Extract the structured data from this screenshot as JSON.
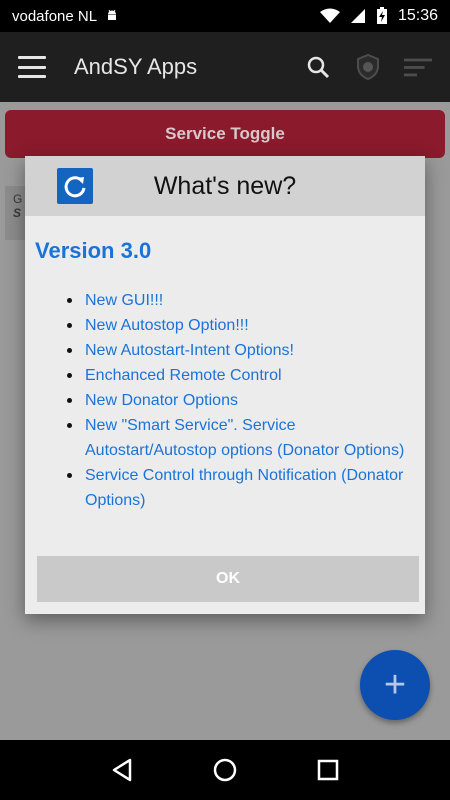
{
  "status_bar": {
    "carrier": "vodafone NL",
    "time": "15:36"
  },
  "app_bar": {
    "title": "AndSY Apps"
  },
  "content": {
    "service_toggle_label": "Service Toggle",
    "card_line1": "G",
    "card_line2": "S"
  },
  "dialog": {
    "title": "What's new?",
    "version": "Version 3.0",
    "changes": [
      "New GUI!!!",
      "New Autostop Option!!!",
      "New Autostart-Intent Options!",
      "Enchanced Remote Control",
      "New Donator Options",
      "New \"Smart Service\". Service Autostart/Autostop options (Donator Options)",
      "Service Control through Notification (Donator Options)"
    ],
    "ok_label": "OK"
  },
  "fab": {
    "label": "+"
  },
  "colors": {
    "accent": "#1a73d9",
    "toggle": "#c0213e",
    "fab": "#1565c0"
  }
}
